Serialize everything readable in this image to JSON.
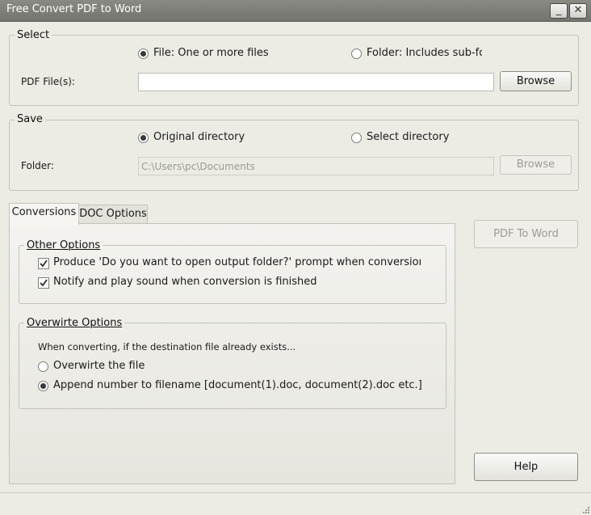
{
  "window": {
    "title": "Free Convert PDF to Word"
  },
  "select": {
    "legend": "Select",
    "option_file": "File:  One or more files",
    "option_folder": "Folder: Includes sub-folders",
    "pdf_label": "PDF File(s):",
    "pdf_value": "",
    "browse": "Browse"
  },
  "save": {
    "legend": "Save",
    "option_original": "Original directory",
    "option_select": "Select directory",
    "folder_label": "Folder:",
    "folder_value": "C:\\Users\\pc\\Documents",
    "browse": "Browse"
  },
  "tabs": [
    {
      "label": "Conversions"
    },
    {
      "label": "DOC Options"
    }
  ],
  "other_options": {
    "legend": "Other Options",
    "prompt": "Produce 'Do you want to open output folder?' prompt when conversion is finished",
    "notify": "Notify and play sound when conversion is finished"
  },
  "overwrite_options": {
    "legend": "Overwirte Options",
    "description": "When converting, if the destination file already exists...",
    "overwrite": "Overwirte the file",
    "append": "Append number to filename  [document(1).doc, document(2).doc etc.]"
  },
  "actions": {
    "convert": "PDF To Word",
    "help": "Help"
  },
  "icons": [
    "minimize-icon",
    "close-icon",
    "checkmark-icon",
    "resize-grip-icon"
  ]
}
